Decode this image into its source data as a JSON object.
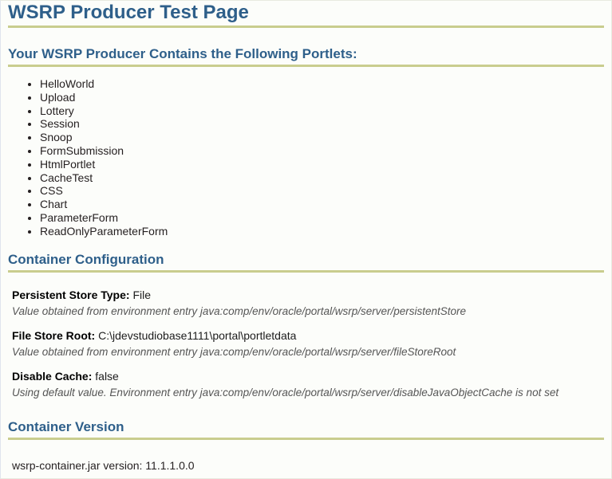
{
  "page": {
    "title": "WSRP Producer Test Page",
    "accent_heading_color": "#2e5f8a",
    "rule_color": "#c9cd8e",
    "background_color": "#fcfdfa"
  },
  "portlets_section": {
    "heading": "Your WSRP Producer Contains the Following Portlets:",
    "items": [
      {
        "label": "HelloWorld"
      },
      {
        "label": "Upload"
      },
      {
        "label": "Lottery"
      },
      {
        "label": "Session"
      },
      {
        "label": "Snoop"
      },
      {
        "label": "FormSubmission"
      },
      {
        "label": "HtmlPortlet"
      },
      {
        "label": "CacheTest"
      },
      {
        "label": "CSS"
      },
      {
        "label": "Chart"
      },
      {
        "label": "ParameterForm"
      },
      {
        "label": "ReadOnlyParameterForm"
      }
    ]
  },
  "container_configuration": {
    "heading": "Container Configuration",
    "entries": [
      {
        "label": "Persistent Store Type:",
        "value": "File",
        "note": "Value obtained from environment entry java:comp/env/oracle/portal/wsrp/server/persistentStore"
      },
      {
        "label": "File Store Root:",
        "value": "C:\\jdevstudiobase1111\\portal\\portletdata",
        "note": "Value obtained from environment entry java:comp/env/oracle/portal/wsrp/server/fileStoreRoot"
      },
      {
        "label": "Disable Cache:",
        "value": "false",
        "note": "Using default value. Environment entry java:comp/env/oracle/portal/wsrp/server/disableJavaObjectCache is not set"
      }
    ]
  },
  "container_version": {
    "heading": "Container Version",
    "version_line": "wsrp-container.jar version: 11.1.1.0.0"
  }
}
